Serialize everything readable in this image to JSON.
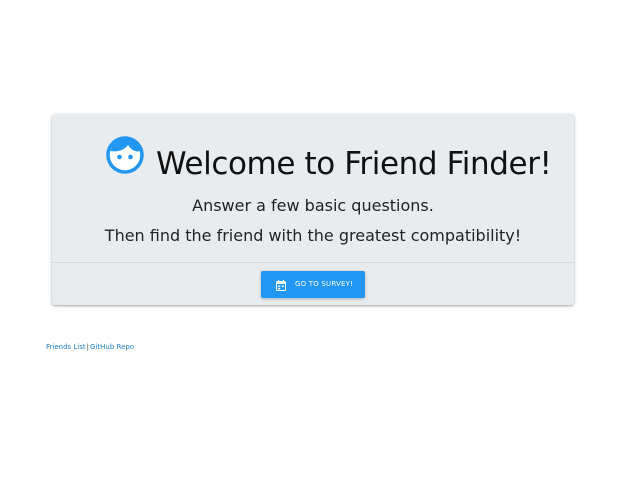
{
  "card": {
    "title": "Welcome to Friend Finder!",
    "line1": "Answer a few basic questions.",
    "line2": "Then find the friend with the greatest compatibility!",
    "title_icon": "face-icon",
    "button": {
      "label": "Go to Survey!",
      "icon": "calendar-icon"
    }
  },
  "footer": {
    "friends_link": "Friends List",
    "separator": "|",
    "github_link": "GitHub Repo"
  },
  "colors": {
    "accent": "#2196f3",
    "card_background": "#e9ecef",
    "link": "#1f7fc6"
  }
}
